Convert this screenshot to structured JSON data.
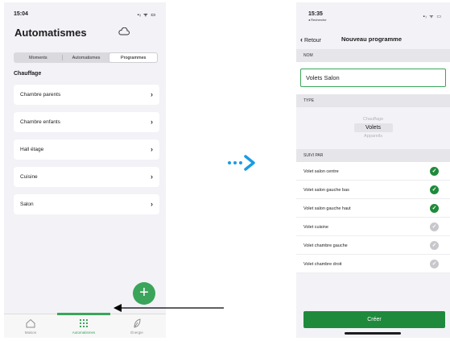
{
  "left": {
    "status": {
      "time": "15:04",
      "icons": "▪ᵢ ᯤ ▭"
    },
    "title": "Automatismes",
    "segments": [
      "Moments",
      "Automatismes",
      "Programmes"
    ],
    "active_segment": "Programmes",
    "section_title": "Chauffage",
    "items": [
      {
        "label": "Chambre parents"
      },
      {
        "label": "Chambre enfants"
      },
      {
        "label": "Hall étage"
      },
      {
        "label": "Cuisine"
      },
      {
        "label": "Salon"
      }
    ],
    "fab_label": "+",
    "tabs": [
      {
        "label": "Maison",
        "icon": "home-icon"
      },
      {
        "label": "Automatismes",
        "icon": "grid-icon"
      },
      {
        "label": "Énergie",
        "icon": "leaf-icon"
      }
    ],
    "active_tab": "Automatismes"
  },
  "right": {
    "status": {
      "time": "15:35",
      "back_hint": "◂ Recherche",
      "icons": "▪ᵢ ᯤ ▭"
    },
    "nav": {
      "back_label": "Retour",
      "title": "Nouveau programme"
    },
    "sections": {
      "nom": "NOM",
      "type": "TYPE",
      "suivi": "SUIVI PAR"
    },
    "name_value": "Volets Salon",
    "picker": [
      "Chauffage",
      "Volets",
      "Appareils"
    ],
    "picker_selected": "Volets",
    "rows": [
      {
        "label": "Volet salon centre",
        "checked": true
      },
      {
        "label": "Volet salon gauche bas",
        "checked": true
      },
      {
        "label": "Volet salon gauche haut",
        "checked": true
      },
      {
        "label": "Volet cuisine",
        "checked": false
      },
      {
        "label": "Volet chambre gauche",
        "checked": false
      },
      {
        "label": "Volet chambre droit",
        "checked": false
      }
    ],
    "create_label": "Créer"
  },
  "colors": {
    "green": "#3aa55a",
    "dark_green": "#1f8a3b",
    "flow_arrow": "#1a9be6",
    "pointer": "#000000"
  }
}
